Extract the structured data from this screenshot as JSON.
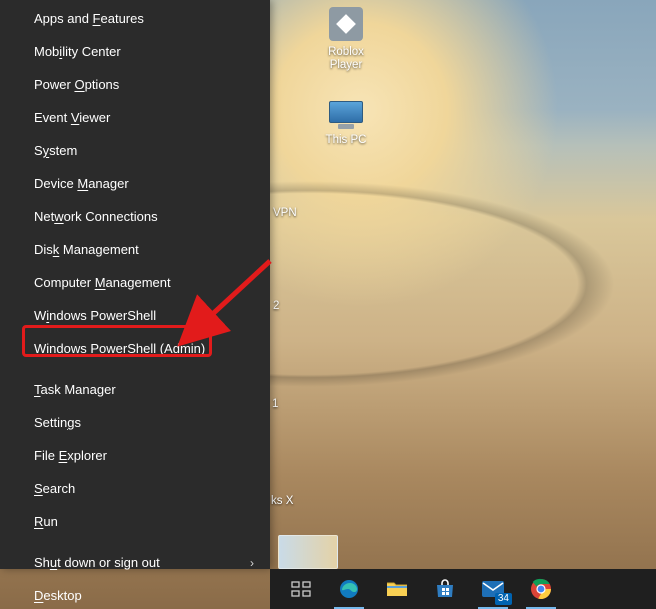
{
  "winx": {
    "groups": [
      {
        "items": [
          {
            "id": "apps-and-features",
            "label": "Apps and Features",
            "accel_index": 9,
            "submenu": false,
            "highlight": false
          },
          {
            "id": "mobility-center",
            "label": "Mobility Center",
            "accel_index": 3,
            "submenu": false,
            "highlight": false
          },
          {
            "id": "power-options",
            "label": "Power Options",
            "accel_index": 6,
            "submenu": false,
            "highlight": false
          },
          {
            "id": "event-viewer",
            "label": "Event Viewer",
            "accel_index": 6,
            "submenu": false,
            "highlight": false
          },
          {
            "id": "system",
            "label": "System",
            "accel_index": 1,
            "submenu": false,
            "highlight": false
          },
          {
            "id": "device-manager",
            "label": "Device Manager",
            "accel_index": 7,
            "submenu": false,
            "highlight": false
          },
          {
            "id": "network-connections",
            "label": "Network Connections",
            "accel_index": 3,
            "submenu": false,
            "highlight": false
          },
          {
            "id": "disk-management",
            "label": "Disk Management",
            "accel_index": 3,
            "submenu": false,
            "highlight": false
          },
          {
            "id": "computer-management",
            "label": "Computer Management",
            "accel_index": 9,
            "submenu": false,
            "highlight": false
          },
          {
            "id": "powershell",
            "label": "Windows PowerShell",
            "accel_index": 1,
            "submenu": false,
            "highlight": false
          },
          {
            "id": "powershell-admin",
            "label": "Windows PowerShell (Admin)",
            "accel_index": 20,
            "submenu": false,
            "highlight": true
          }
        ]
      },
      {
        "items": [
          {
            "id": "task-manager",
            "label": "Task Manager",
            "accel_index": 0,
            "submenu": false,
            "highlight": false
          },
          {
            "id": "settings",
            "label": "Settings",
            "accel_index": 6,
            "submenu": false,
            "highlight": false
          },
          {
            "id": "file-explorer",
            "label": "File Explorer",
            "accel_index": 5,
            "submenu": false,
            "highlight": false
          },
          {
            "id": "search",
            "label": "Search",
            "accel_index": 0,
            "submenu": false,
            "highlight": false
          },
          {
            "id": "run",
            "label": "Run",
            "accel_index": 0,
            "submenu": false,
            "highlight": false
          }
        ]
      },
      {
        "items": [
          {
            "id": "shutdown-signout",
            "label": "Shut down or sign out",
            "accel_index": 2,
            "submenu": true,
            "highlight": false
          },
          {
            "id": "desktop",
            "label": "Desktop",
            "accel_index": 0,
            "submenu": false,
            "highlight": false
          }
        ]
      }
    ]
  },
  "desktop_icons": {
    "roblox": "Roblox\nPlayer",
    "this_pc": "This PC",
    "vpn_fragment": "VPN",
    "partial_right_1": "2",
    "partial_right_2": "1",
    "partial_right_3": "ks X"
  },
  "taskbar": {
    "mail_badge": "34"
  },
  "colors": {
    "callout_red": "#e21b1b",
    "menu_bg": "#2b2b2b",
    "taskbar_bg": "#1f1f1f"
  }
}
